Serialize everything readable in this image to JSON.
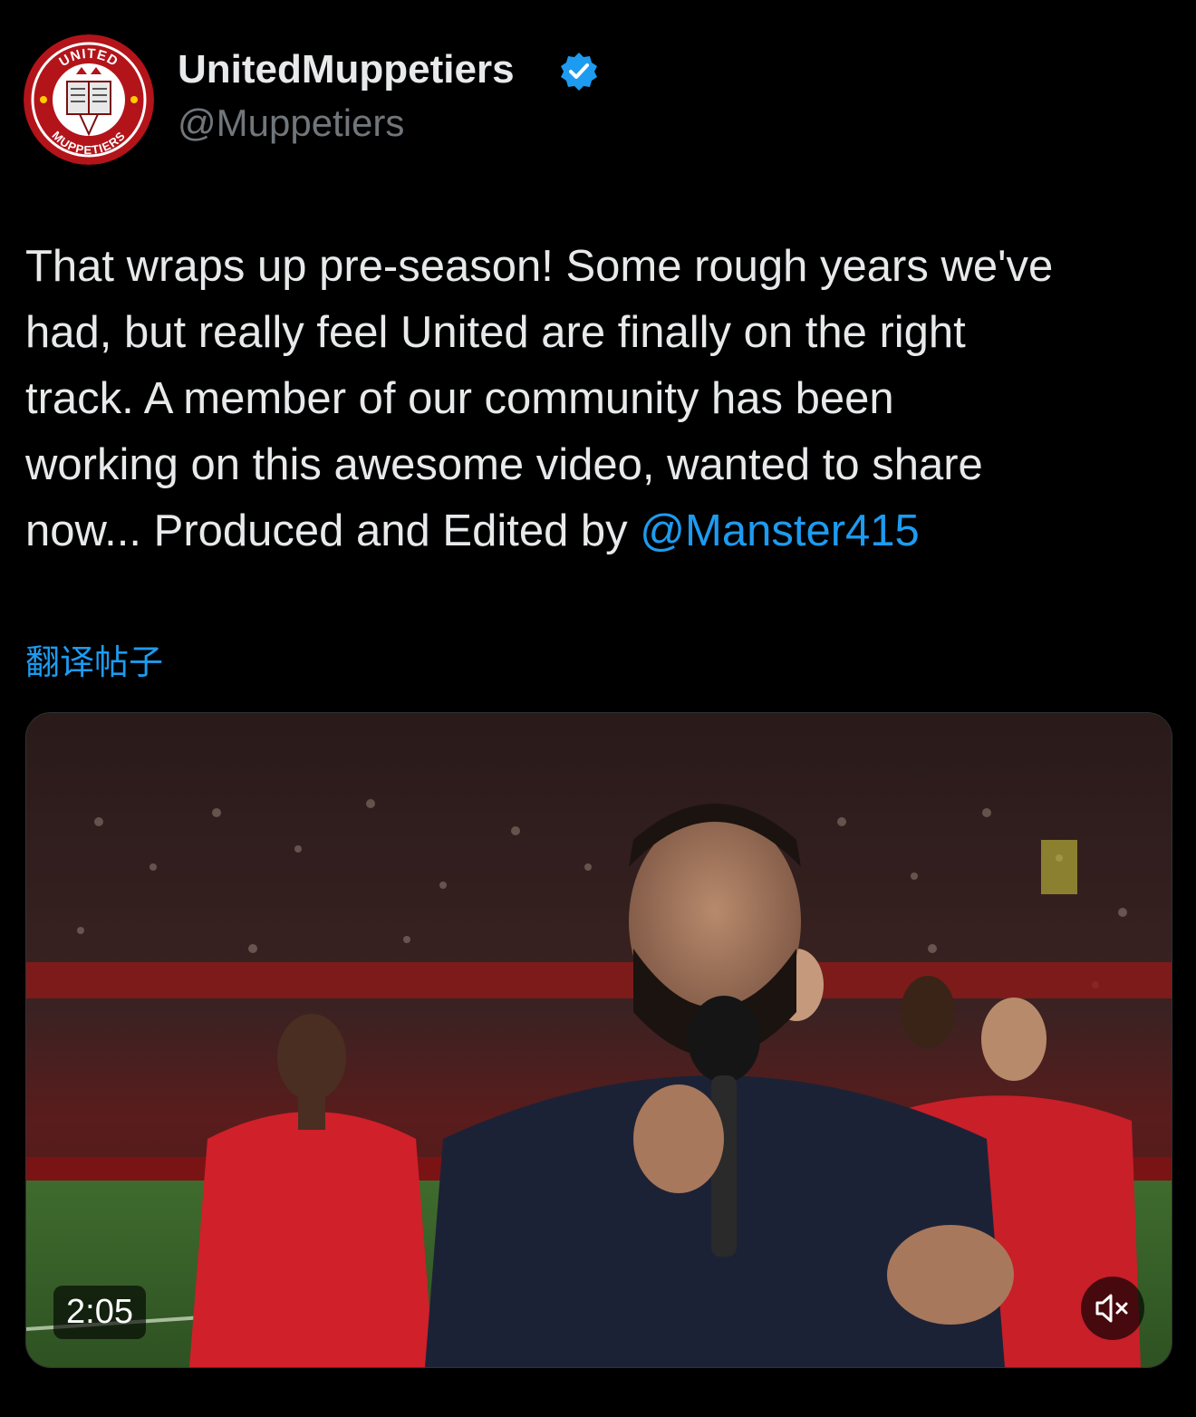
{
  "post": {
    "display_name": "UnitedMuppetiers",
    "handle": "@Muppetiers",
    "verified_icon": "verified-badge-icon",
    "avatar": {
      "top_text": "UNITED",
      "bottom_text": "MUPPETIERS",
      "colors": {
        "ring": "#b3141a",
        "face": "#ffffff"
      }
    },
    "text_lines": [
      "That wraps up pre-season! Some rough years we've",
      "had, but really feel United are finally on the right",
      "track. A member of our community has been",
      "working on this awesome video, wanted to share"
    ],
    "last_line_prefix": "now... Produced and Edited by ",
    "mention": "@Manster415",
    "translate_label": "翻译帖子",
    "media": {
      "type": "video",
      "duration": "2:05",
      "muted": true,
      "mute_icon": "speaker-muted-icon"
    },
    "colors": {
      "background": "#000000",
      "text": "#e7e9ea",
      "secondary_text": "#71767b",
      "link": "#1d9bf0",
      "verified": "#1d9bf0"
    }
  }
}
